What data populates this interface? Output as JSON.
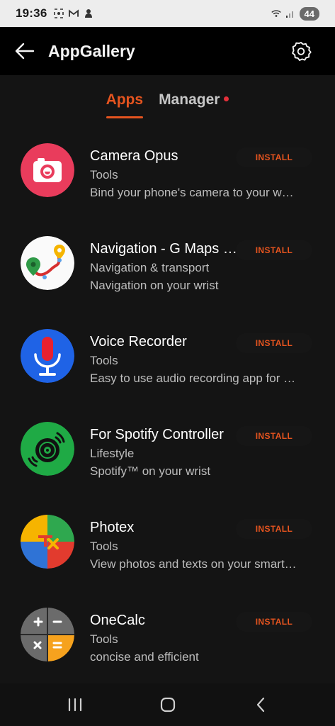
{
  "status_bar": {
    "time": "19:36",
    "battery": "44",
    "icons": [
      "screenshot-icon",
      "gmail-icon",
      "app-icon",
      "wifi-icon",
      "signal-icon"
    ]
  },
  "header": {
    "title": "AppGallery"
  },
  "tabs": [
    {
      "label": "Apps",
      "active": true
    },
    {
      "label": "Manager",
      "has_badge": true
    }
  ],
  "apps": [
    {
      "name": "Camera Opus",
      "category": "Tools",
      "description": "Bind your phone's camera to your watch",
      "action": "INSTALL",
      "icon": "camera-icon"
    },
    {
      "name": "Navigation - G Maps Navigation",
      "category": "Navigation & transport",
      "description": "Navigation on your wrist",
      "action": "INSTALL",
      "icon": "map-pin-icon"
    },
    {
      "name": "Voice Recorder",
      "category": "Tools",
      "description": "Easy to use audio recording app for your watch",
      "action": "INSTALL",
      "icon": "microphone-icon"
    },
    {
      "name": "For Spotify Controller",
      "category": "Lifestyle",
      "description": "Spotify™ on your wrist",
      "action": "INSTALL",
      "icon": "spotify-disc-icon"
    },
    {
      "name": "Photex",
      "category": "Tools",
      "description": "View photos and texts on your smartwatch",
      "action": "INSTALL",
      "icon": "photex-icon"
    },
    {
      "name": "OneCalc",
      "category": "Tools",
      "description": "concise and efficient",
      "action": "INSTALL",
      "icon": "calculator-icon"
    }
  ],
  "colors": {
    "accent": "#e5541f",
    "background": "#141414"
  }
}
